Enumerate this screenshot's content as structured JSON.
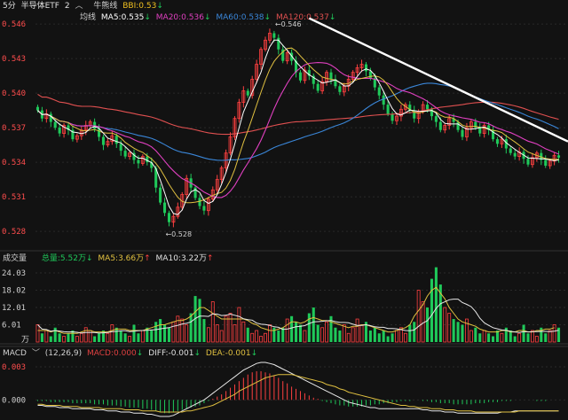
{
  "header": {
    "period": "5分",
    "name": "半导体ETF",
    "pane_count": "2",
    "chevron_icon": "chevron-up-icon",
    "bull_bear_label": "牛熊线",
    "bbi": "BBI:0.53",
    "ma_label": "均线",
    "ma5": "MA5:0.535",
    "ma20": "MA20:0.536",
    "ma60": "MA60:0.538",
    "ma120": "MA120:0.537",
    "up_arrow": "↑",
    "down_arrow": "↓"
  },
  "colors": {
    "up": "#ff4040",
    "down": "#1fc95a",
    "ma5": "#ffffff",
    "ma10": "#e0c040",
    "ma20": "#e040c0",
    "ma60": "#3a86d8",
    "ma120": "#e05050",
    "trend": "#ffffff",
    "bbi": "#f0c020",
    "macd_label": "#e04040",
    "dea": "#e0c040"
  },
  "volume_header": {
    "label": "成交量",
    "total": "总量:5.52万",
    "ma5": "MA5:3.66万",
    "ma10": "MA10:3.22万"
  },
  "macd_header": {
    "label": "MACD",
    "params": "(12,26,9)",
    "macd": "MACD:0.000",
    "diff": "DIFF:-0.001",
    "dea": "DEA:-0.001"
  },
  "chart_data": [
    {
      "type": "candlestick",
      "title": "半导体ETF 5分",
      "y_ticks": [
        "0.546",
        "0.543",
        "0.540",
        "0.537",
        "0.534",
        "0.531",
        "0.528"
      ],
      "ylim": [
        0.5267,
        0.5467
      ],
      "annotations": {
        "high": "0.546",
        "low": "0.528"
      },
      "num_bars": 120,
      "price": [
        0.5385,
        0.5378,
        0.5382,
        0.5375,
        0.537,
        0.5365,
        0.5372,
        0.5368,
        0.536,
        0.5363,
        0.5368,
        0.5372,
        0.5375,
        0.5369,
        0.5362,
        0.5355,
        0.5358,
        0.5363,
        0.5356,
        0.535,
        0.5345,
        0.5348,
        0.5342,
        0.5339,
        0.5345,
        0.534,
        0.5335,
        0.5318,
        0.5305,
        0.5296,
        0.5288,
        0.5293,
        0.5301,
        0.5312,
        0.5326,
        0.5318,
        0.5309,
        0.5302,
        0.5298,
        0.5308,
        0.5316,
        0.5325,
        0.5335,
        0.5348,
        0.5362,
        0.5378,
        0.5392,
        0.5402,
        0.5398,
        0.5412,
        0.5425,
        0.5438,
        0.5446,
        0.5452,
        0.5448,
        0.5438,
        0.5428,
        0.5435,
        0.5428,
        0.5418,
        0.5411,
        0.542,
        0.5415,
        0.5408,
        0.5402,
        0.541,
        0.5418,
        0.5412,
        0.5406,
        0.5401,
        0.5406,
        0.5412,
        0.5418,
        0.5422,
        0.5425,
        0.5419,
        0.5413,
        0.5405,
        0.5398,
        0.539,
        0.5382,
        0.5376,
        0.538,
        0.5386,
        0.539,
        0.5385,
        0.5378,
        0.5384,
        0.539,
        0.5386,
        0.538,
        0.5375,
        0.5368,
        0.5372,
        0.5378,
        0.5375,
        0.5368,
        0.5362,
        0.537,
        0.5375,
        0.537,
        0.5365,
        0.5372,
        0.5368,
        0.536,
        0.5356,
        0.536,
        0.5352,
        0.5348,
        0.5345,
        0.5349,
        0.5343,
        0.5338,
        0.5344,
        0.5348,
        0.5342,
        0.5337,
        0.5341,
        0.5346,
        0.5344
      ],
      "trend_line": {
        "start": {
          "bar": 62,
          "value": 0.5465
        },
        "end": {
          "bar": 119,
          "value": 0.5358
        }
      }
    },
    {
      "type": "bar",
      "title": "成交量",
      "unit": "万",
      "y_ticks": [
        "24.03",
        "18.02",
        "12.01",
        "6.01"
      ],
      "ylim": [
        0,
        26.5
      ],
      "values": [
        6,
        3,
        4,
        2,
        5,
        3,
        2,
        3,
        4,
        2,
        3,
        5,
        4,
        2,
        3,
        4,
        3,
        6,
        5,
        4,
        3,
        2,
        6,
        3,
        4,
        5,
        4,
        7,
        8,
        6,
        5,
        7,
        9,
        8,
        6,
        10,
        16,
        15,
        8,
        5,
        14,
        6,
        4,
        9,
        10,
        6,
        12,
        7,
        5,
        3,
        4,
        2,
        3,
        6,
        5,
        4,
        5,
        8,
        9,
        7,
        6,
        4,
        10,
        12,
        6,
        5,
        7,
        9,
        5,
        4,
        6,
        3,
        5,
        8,
        6,
        7,
        4,
        5,
        3,
        4,
        2,
        3,
        4,
        5,
        3,
        6,
        7,
        18,
        14,
        12,
        22,
        26,
        20,
        12,
        10,
        8,
        7,
        6,
        8,
        4,
        5,
        3,
        4,
        3,
        2,
        4,
        3,
        5,
        4,
        2,
        3,
        6,
        3,
        4,
        2,
        5,
        3,
        4,
        6,
        5
      ],
      "ma5": [
        4,
        4,
        4,
        3.5,
        4,
        3.5,
        3,
        3,
        3,
        3,
        3.5,
        4,
        4,
        3.5,
        3.5,
        3.5,
        3.5,
        4,
        4.5,
        4.5,
        4.5,
        4,
        4,
        4,
        4,
        4.5,
        5,
        5.5,
        6,
        6,
        6.5,
        7,
        7.5,
        7.5,
        8,
        9,
        10.5,
        12,
        12,
        11,
        10,
        9,
        8,
        8,
        8,
        8,
        8,
        8,
        7.5,
        6.5,
        6,
        5,
        4.5,
        4,
        4,
        4.5,
        5,
        6,
        7,
        7,
        6.5,
        7,
        8,
        8.5,
        8,
        7.5,
        7.5,
        7,
        6.5,
        6,
        5.5,
        5,
        5.5,
        5.5,
        6,
        6,
        5.5,
        5,
        4.5,
        4,
        3.5,
        3.5,
        4,
        4.5,
        5,
        6,
        9,
        11,
        13,
        16,
        18,
        19,
        17,
        15,
        12,
        10,
        8,
        7,
        6.5,
        6,
        5.5,
        4.5,
        4,
        3.5,
        3.5,
        3.5,
        4,
        4,
        3.5,
        3.5,
        4,
        4,
        3.5,
        3.5,
        4,
        4,
        4.5,
        4.5,
        5
      ]
    },
    {
      "type": "bar",
      "title": "MACD",
      "y_ticks": [
        "0.003",
        "0.000"
      ],
      "ylim": [
        -0.0015,
        0.0038
      ],
      "macd": [
        -0.0001,
        -0.0001,
        -0.0001,
        -0.0002,
        -0.0002,
        -0.0002,
        -0.0002,
        -0.0002,
        -0.0003,
        -0.0003,
        -0.0003,
        -0.0003,
        -0.0003,
        -0.0004,
        -0.0004,
        -0.0004,
        -0.0005,
        -0.0005,
        -0.0005,
        -0.0006,
        -0.0006,
        -0.0007,
        -0.0007,
        -0.0007,
        -0.0008,
        -0.0008,
        -0.0009,
        -0.001,
        -0.0011,
        -0.0012,
        -0.0012,
        -0.0011,
        -0.001,
        -0.0009,
        -0.0008,
        -0.0007,
        -0.0006,
        -0.0005,
        -0.0003,
        -0.0001,
        0.0001,
        0.0003,
        0.0005,
        0.0008,
        0.0011,
        0.0014,
        0.0017,
        0.002,
        0.0023,
        0.0025,
        0.0026,
        0.0026,
        0.0025,
        0.0024,
        0.0022,
        0.002,
        0.0017,
        0.0015,
        0.0012,
        0.001,
        0.0008,
        0.0006,
        0.0004,
        0.0002,
        0.0001,
        -0.0001,
        -0.0002,
        -0.0003,
        -0.0004,
        -0.0005,
        -0.0005,
        -0.0006,
        -0.0006,
        -0.0006,
        -0.0006,
        -0.0005,
        -0.0005,
        -0.0004,
        -0.0004,
        -0.0003,
        -0.0003,
        -0.0002,
        -0.0002,
        -0.0001,
        -0.0001,
        -0.0001,
        0,
        0,
        -0.0001,
        -0.0001,
        -0.0002,
        -0.0002,
        -0.0003,
        -0.0003,
        -0.0003,
        -0.0004,
        -0.0004,
        -0.0004,
        -0.0004,
        -0.0004,
        -0.0003,
        -0.0003,
        -0.0003,
        -0.0002,
        -0.0002,
        -0.0002,
        -0.0001,
        -0.0001,
        -0.0001,
        0,
        0,
        0,
        0,
        0,
        -0.0001,
        -0.0001,
        -0.0001,
        0,
        0,
        0
      ],
      "diff": [
        -0.0005,
        -0.0005,
        -0.0006,
        -0.0006,
        -0.0006,
        -0.0007,
        -0.0007,
        -0.0007,
        -0.0008,
        -0.0008,
        -0.0008,
        -0.0008,
        -0.0008,
        -0.0009,
        -0.0009,
        -0.0009,
        -0.001,
        -0.001,
        -0.001,
        -0.0011,
        -0.0011,
        -0.0011,
        -0.0012,
        -0.0012,
        -0.0012,
        -0.0013,
        -0.0013,
        -0.0014,
        -0.0015,
        -0.0015,
        -0.0015,
        -0.0014,
        -0.0012,
        -0.001,
        -0.0008,
        -0.0006,
        -0.0004,
        -0.0002,
        0,
        0.0003,
        0.0006,
        0.0009,
        0.0012,
        0.0015,
        0.0018,
        0.0021,
        0.0024,
        0.0027,
        0.0029,
        0.0031,
        0.0033,
        0.0034,
        0.0034,
        0.0033,
        0.0032,
        0.003,
        0.0028,
        0.0026,
        0.0024,
        0.0022,
        0.002,
        0.0018,
        0.0016,
        0.0014,
        0.0012,
        0.001,
        0.0008,
        0.0006,
        0.0004,
        0.0002,
        0,
        -0.0002,
        -0.0003,
        -0.0004,
        -0.0005,
        -0.0006,
        -0.0007,
        -0.0007,
        -0.0008,
        -0.0008,
        -0.0008,
        -0.0008,
        -0.0008,
        -0.0008,
        -0.0008,
        -0.0008,
        -0.0008,
        -0.0008,
        -0.0009,
        -0.0009,
        -0.001,
        -0.001,
        -0.001,
        -0.0011,
        -0.0011,
        -0.0011,
        -0.0012,
        -0.0012,
        -0.0012,
        -0.0012,
        -0.0012,
        -0.0012,
        -0.0012,
        -0.0012,
        -0.0012,
        -0.0012,
        -0.0011,
        -0.0011,
        -0.0011,
        -0.001,
        -0.001,
        -0.001,
        -0.001,
        -0.001,
        -0.001,
        -0.001,
        -0.001,
        -0.001,
        -0.001,
        -0.001
      ],
      "dea": [
        -0.0004,
        -0.0004,
        -0.0005,
        -0.0005,
        -0.0005,
        -0.0005,
        -0.0006,
        -0.0006,
        -0.0006,
        -0.0006,
        -0.0007,
        -0.0007,
        -0.0007,
        -0.0007,
        -0.0007,
        -0.0008,
        -0.0008,
        -0.0008,
        -0.0008,
        -0.0008,
        -0.0009,
        -0.0009,
        -0.0009,
        -0.0009,
        -0.001,
        -0.001,
        -0.001,
        -0.001,
        -0.0011,
        -0.0011,
        -0.0011,
        -0.0011,
        -0.0011,
        -0.0011,
        -0.001,
        -0.001,
        -0.0009,
        -0.0008,
        -0.0007,
        -0.0006,
        -0.0005,
        -0.0003,
        -0.0001,
        0.0001,
        0.0003,
        0.0005,
        0.0008,
        0.001,
        0.0012,
        0.0014,
        0.0016,
        0.0018,
        0.002,
        0.0021,
        0.0022,
        0.0023,
        0.0023,
        0.0023,
        0.0023,
        0.0022,
        0.0021,
        0.002,
        0.0019,
        0.0018,
        0.0017,
        0.0016,
        0.0014,
        0.0013,
        0.0012,
        0.001,
        0.0009,
        0.0007,
        0.0006,
        0.0005,
        0.0004,
        0.0003,
        0.0002,
        0.0001,
        0,
        -0.0001,
        -0.0002,
        -0.0003,
        -0.0004,
        -0.0005,
        -0.0005,
        -0.0006,
        -0.0006,
        -0.0007,
        -0.0007,
        -0.0007,
        -0.0008,
        -0.0008,
        -0.0008,
        -0.0009,
        -0.0009,
        -0.0009,
        -0.001,
        -0.001,
        -0.001,
        -0.001,
        -0.0011,
        -0.0011,
        -0.0011,
        -0.0011,
        -0.0011,
        -0.0011,
        -0.0011,
        -0.0011,
        -0.0011,
        -0.0011,
        -0.001,
        -0.001,
        -0.001,
        -0.001,
        -0.001,
        -0.001,
        -0.001,
        -0.001,
        -0.001,
        -0.001
      ]
    }
  ]
}
